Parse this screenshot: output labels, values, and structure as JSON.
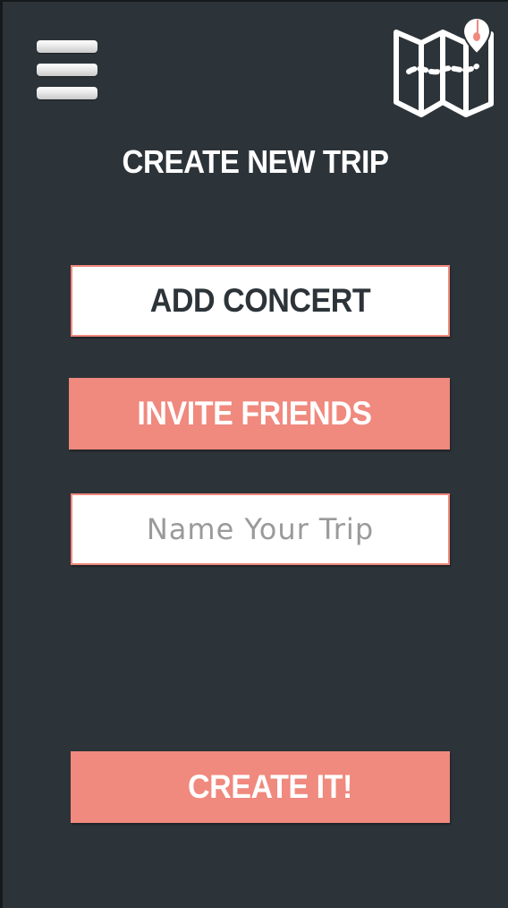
{
  "header": {
    "menu_icon": "hamburger-menu-icon",
    "logo_icon": "folded-map-with-guitar-pin-icon",
    "title": "CREATE NEW TRIP"
  },
  "actions": {
    "add_concert_label": "ADD CONCERT",
    "invite_friends_label": "INVITE FRIENDS",
    "create_label": "CREATE IT!"
  },
  "trip_name": {
    "value": "",
    "placeholder": "Name Your Trip"
  },
  "colors": {
    "background": "#2d3439",
    "accent": "#f0897e",
    "white": "#ffffff"
  }
}
